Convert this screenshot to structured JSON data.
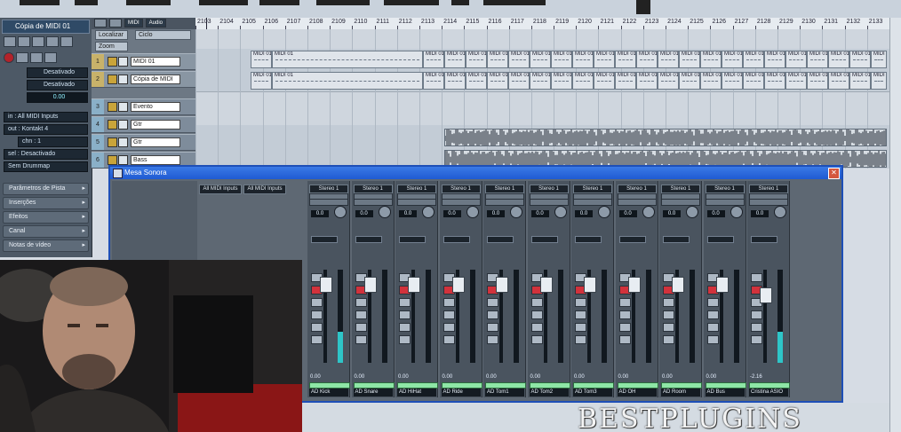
{
  "inspector": {
    "track_name": "Cópia de MIDI 01",
    "fields": [
      "Desativado",
      "Desativado"
    ],
    "volume_value": "0.00",
    "input_routing": "in : All MIDI Inputs",
    "output_routing": "out : Kontakt 4",
    "channel_label": "chn : 1",
    "bank_label": "sel : Desactivado",
    "drum_label": "Sem Drummap",
    "sections": [
      "Parâmetros de Pista",
      "Inserções",
      "Efeitos",
      "Canal",
      "Notas de vídeo"
    ]
  },
  "tracklist": {
    "toolbar": [
      "MIDI",
      "Audio"
    ],
    "selectors": [
      "Localizar",
      "Zoom",
      "Ciclo"
    ],
    "tracks": [
      {
        "num": "1",
        "name": "MIDI 01",
        "type": "midi"
      },
      {
        "num": "2",
        "name": "Cópia de MIDI",
        "type": "midi"
      },
      {
        "num": "3",
        "name": "Evento",
        "type": "audio"
      },
      {
        "num": "4",
        "name": "Gtr",
        "type": "audio"
      },
      {
        "num": "5",
        "name": "Gtr",
        "type": "audio"
      },
      {
        "num": "6",
        "name": "Bass",
        "type": "audio"
      }
    ]
  },
  "ruler": {
    "ticks": [
      "2103",
      "2104",
      "2105",
      "2106",
      "2107",
      "2108",
      "2109",
      "2110",
      "2111",
      "2112",
      "2113",
      "2114",
      "2115",
      "2116",
      "2117",
      "2118",
      "2119",
      "2120",
      "2121",
      "2122",
      "2123",
      "2124",
      "2125",
      "2126",
      "2127",
      "2128",
      "2129",
      "2130",
      "2131",
      "2132",
      "2133"
    ]
  },
  "arrange": {
    "part_label": "MIDI 01"
  },
  "mixer": {
    "title": "Mesa Sonora",
    "inputs": [
      {
        "routing": "All MIDI Inputs",
        "out": "Kontakt 4"
      },
      {
        "routing": "All MIDI Inputs",
        "out": "Kontakt 4"
      }
    ],
    "channels": [
      {
        "route": "Stereo 1",
        "value": "0.0",
        "readout": "0.00",
        "name": "AD Kick"
      },
      {
        "route": "Stereo 1",
        "value": "0.0",
        "readout": "0.00",
        "name": "AD Snare"
      },
      {
        "route": "Stereo 1",
        "value": "0.0",
        "readout": "0.00",
        "name": "AD HiHat"
      },
      {
        "route": "Stereo 1",
        "value": "0.0",
        "readout": "0.00",
        "name": "AD Ride"
      },
      {
        "route": "Stereo 1",
        "value": "0.0",
        "readout": "0.00",
        "name": "AD Tom1"
      },
      {
        "route": "Stereo 1",
        "value": "0.0",
        "readout": "0.00",
        "name": "AD Tom2"
      },
      {
        "route": "Stereo 1",
        "value": "0.0",
        "readout": "0.00",
        "name": "AD Tom3"
      },
      {
        "route": "Stereo 1",
        "value": "0.0",
        "readout": "0.00",
        "name": "AD OH"
      },
      {
        "route": "Stereo 1",
        "value": "0.0",
        "readout": "0.00",
        "name": "AD Room"
      },
      {
        "route": "Stereo 1",
        "value": "0.0",
        "readout": "0.00",
        "name": "AD Bus"
      },
      {
        "route": "Stereo 1",
        "value": "0.0",
        "readout": "-2.16",
        "name": "Cristina ASIO"
      }
    ]
  },
  "watermark": "BESTPLUGINS"
}
